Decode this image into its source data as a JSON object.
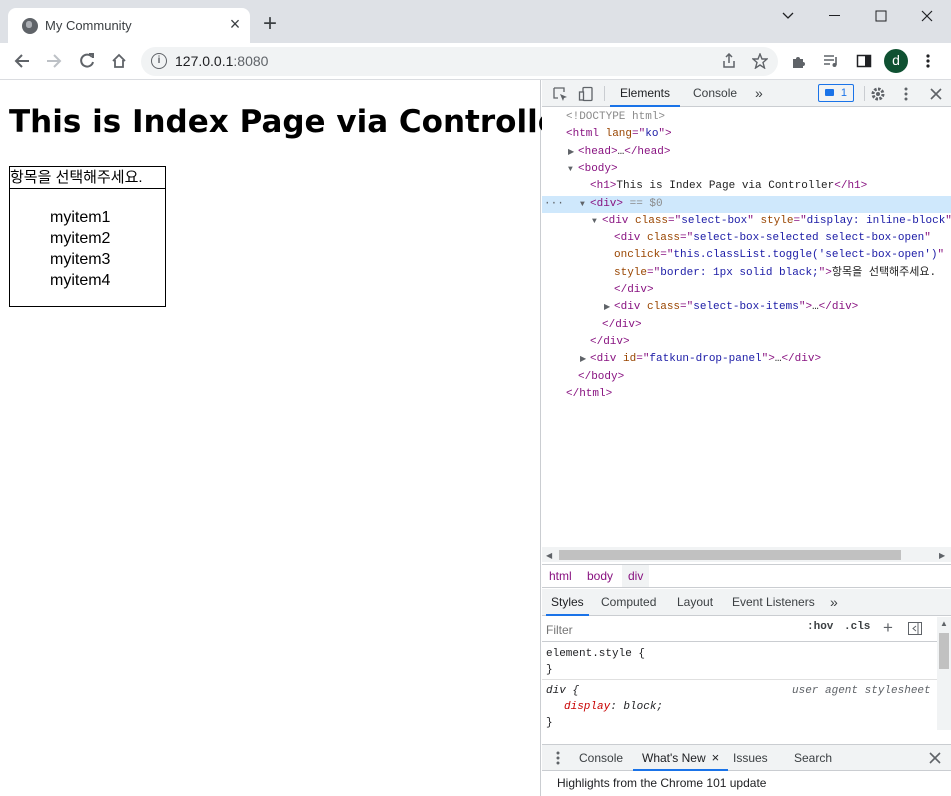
{
  "browser": {
    "tab_title": "My Community",
    "new_tab_label": "+",
    "url_host": "127.0.0.1",
    "url_port": ":8080",
    "profile_initial": "d"
  },
  "page": {
    "heading": "This is Index Page via Controller",
    "select_box": {
      "selected_label": "항목을 선택해주세요.",
      "items": [
        "myitem1",
        "myitem2",
        "myitem3",
        "myitem4"
      ]
    }
  },
  "devtools": {
    "tabs": [
      "Elements",
      "Console"
    ],
    "more_tabs": "»",
    "message_count": "1",
    "dom_lines": [
      {
        "indent": 0,
        "tri": "",
        "parts": [
          [
            "cm",
            "<!DOCTYPE html>"
          ]
        ]
      },
      {
        "indent": 0,
        "tri": "",
        "parts": [
          [
            "tg",
            "<html "
          ],
          [
            "an",
            "lang"
          ],
          [
            "tg",
            "=\""
          ],
          [
            "av",
            "ko"
          ],
          [
            "tg",
            "\">"
          ]
        ]
      },
      {
        "indent": 1,
        "tri": "▶",
        "parts": [
          [
            "tg",
            "<head>"
          ],
          [
            "",
            "…"
          ],
          [
            "tg",
            "</head>"
          ]
        ]
      },
      {
        "indent": 1,
        "tri": "▼",
        "parts": [
          [
            "tg",
            "<body>"
          ]
        ]
      },
      {
        "indent": 2,
        "tri": "",
        "parts": [
          [
            "tg",
            "<h1>"
          ],
          [
            "",
            "This is Index Page via Controller"
          ],
          [
            "tg",
            "</h1>"
          ]
        ]
      },
      {
        "indent": 2,
        "tri": "▼",
        "selected": true,
        "parts": [
          [
            "tg",
            "<div>"
          ],
          [
            "cm",
            " == $0"
          ]
        ]
      },
      {
        "indent": 3,
        "tri": "▼",
        "parts": [
          [
            "tg",
            "<div "
          ],
          [
            "an",
            "class"
          ],
          [
            "tg",
            "=\""
          ],
          [
            "av",
            "select-box"
          ],
          [
            "tg",
            "\" "
          ],
          [
            "an",
            "style"
          ],
          [
            "tg",
            "=\""
          ],
          [
            "av",
            "display: inline-block"
          ],
          [
            "tg",
            "\">"
          ]
        ]
      },
      {
        "indent": 4,
        "tri": "",
        "parts": [
          [
            "tg",
            "<div "
          ],
          [
            "an",
            "class"
          ],
          [
            "tg",
            "=\""
          ],
          [
            "av",
            "select-box-selected select-box-open"
          ],
          [
            "tg",
            "\""
          ]
        ]
      },
      {
        "indent": 4,
        "tri": "",
        "parts": [
          [
            "an",
            "onclick"
          ],
          [
            "tg",
            "=\""
          ],
          [
            "av",
            "this.classList.toggle('select-box-open')"
          ],
          [
            "tg",
            "\""
          ]
        ]
      },
      {
        "indent": 4,
        "tri": "",
        "parts": [
          [
            "an",
            "style"
          ],
          [
            "tg",
            "=\""
          ],
          [
            "av",
            "border: 1px solid black;"
          ],
          [
            "tg",
            "\">"
          ],
          [
            "",
            "항목을 선택해주세요."
          ]
        ]
      },
      {
        "indent": 4,
        "tri": "",
        "parts": [
          [
            "tg",
            "</div>"
          ]
        ]
      },
      {
        "indent": 4,
        "tri": "▶",
        "parts": [
          [
            "tg",
            "<div "
          ],
          [
            "an",
            "class"
          ],
          [
            "tg",
            "=\""
          ],
          [
            "av",
            "select-box-items"
          ],
          [
            "tg",
            "\">"
          ],
          [
            "",
            "…"
          ],
          [
            "tg",
            "</div>"
          ]
        ]
      },
      {
        "indent": 3,
        "tri": "",
        "parts": [
          [
            "tg",
            "</div>"
          ]
        ]
      },
      {
        "indent": 2,
        "tri": "",
        "parts": [
          [
            "tg",
            "</div>"
          ]
        ]
      },
      {
        "indent": 2,
        "tri": "▶",
        "parts": [
          [
            "tg",
            "<div "
          ],
          [
            "an",
            "id"
          ],
          [
            "tg",
            "=\""
          ],
          [
            "av",
            "fatkun-drop-panel"
          ],
          [
            "tg",
            "\">"
          ],
          [
            "",
            "…"
          ],
          [
            "tg",
            "</div>"
          ]
        ]
      },
      {
        "indent": 1,
        "tri": "",
        "parts": [
          [
            "tg",
            "</body>"
          ]
        ]
      },
      {
        "indent": 0,
        "tri": "",
        "parts": [
          [
            "tg",
            "</html>"
          ]
        ]
      }
    ],
    "breadcrumbs": [
      "html",
      "body",
      "div"
    ],
    "styles_tabs": [
      "Styles",
      "Computed",
      "Layout",
      "Event Listeners"
    ],
    "filter_placeholder": "Filter",
    "hov_label": ":hov",
    "cls_label": ".cls",
    "rules": {
      "element_style": "element.style {",
      "close1": "}",
      "div_selector": "div {",
      "div_source": "user agent stylesheet",
      "div_prop": "display",
      "div_val": "block;",
      "close2": "}"
    },
    "drawer_tabs": [
      "Console",
      "What's New",
      "Issues",
      "Search"
    ],
    "drawer_body": "Highlights from the Chrome 101 update"
  }
}
